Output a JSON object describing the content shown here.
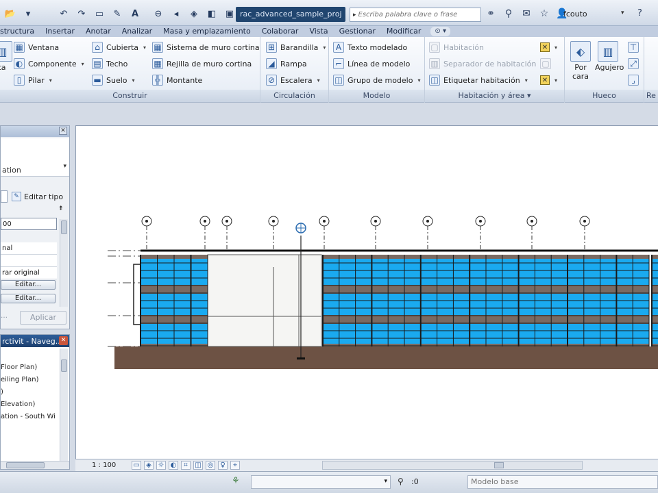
{
  "titlebar": {
    "filename": "rac_advanced_sample_proj",
    "search_placeholder": "Escriba palabra clave o frase",
    "username": "fcouto"
  },
  "menu": {
    "tabs": [
      "structura",
      "Insertar",
      "Anotar",
      "Analizar",
      "Masa y emplazamiento",
      "Colaborar",
      "Vista",
      "Gestionar",
      "Modificar"
    ]
  },
  "ribbon": {
    "construir": {
      "title": "Construir",
      "big_label": "ta",
      "ventana": "Ventana",
      "componente": "Componente",
      "pilar": "Pilar",
      "cubierta": "Cubierta",
      "techo": "Techo",
      "suelo": "Suelo",
      "sistema_muro_cortina": "Sistema de muro cortina",
      "rejilla_muro_cortina": "Rejilla de muro cortina",
      "montante": "Montante"
    },
    "circulacion": {
      "title": "Circulación",
      "barandilla": "Barandilla",
      "rampa": "Rampa",
      "escalera": "Escalera"
    },
    "modelo": {
      "title": "Modelo",
      "texto_modelado": "Texto modelado",
      "linea_modelo": "Línea de modelo",
      "grupo_modelo": "Grupo de modelo"
    },
    "habitacion": {
      "title": "Habitación y área",
      "habitacion": "Habitación",
      "separador": "Separador de habitación",
      "etiquetar": "Etiquetar habitación"
    },
    "hueco": {
      "title": "Hueco",
      "por_cara": "Por cara",
      "agujero": "Agujero"
    },
    "next_title": "Re"
  },
  "properties": {
    "type_name": "ation",
    "edit_type": "Editar tipo",
    "rows": [
      "00",
      "nal",
      "",
      "rar original"
    ],
    "edit_buttons": [
      "Editar...",
      "Editar..."
    ],
    "apply": "Aplicar"
  },
  "navigator": {
    "title": "rctivit - Naveg...",
    "items": [
      "Floor Plan)",
      "eiling Plan)",
      ")",
      "Elevation)",
      "ation - South Wi"
    ]
  },
  "viewbar": {
    "scale": "1 : 100"
  },
  "statusbar": {
    "editable_count": ":0",
    "model": "Modelo base"
  },
  "colors": {
    "curtain_panel": "#1aaaf0",
    "floor_band": "#7a6a62",
    "ground": "#6d5244",
    "title_accent": "#20456f"
  }
}
